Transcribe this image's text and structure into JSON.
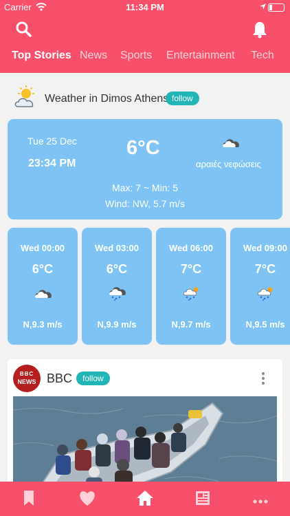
{
  "status": {
    "carrier": "Carrier",
    "time": "11:34 PM"
  },
  "tabs": [
    "Top Stories",
    "News",
    "Sports",
    "Entertainment",
    "Tech"
  ],
  "weather": {
    "title": "Weather in Dimos Athens",
    "follow_label": "follow",
    "date": "Tue 25 Dec",
    "time": "23:34 PM",
    "temp": "6°C",
    "condition": "αραιές νεφώσεις",
    "maxmin": "Max: 7 ~ Min: 5",
    "wind": "Wind: NW, 5.7 m/s"
  },
  "forecast": [
    {
      "time": "Wed 00:00",
      "temp": "6°C",
      "wind": "N,9.3 m/s",
      "icon": "cloudy-icon"
    },
    {
      "time": "Wed 03:00",
      "temp": "6°C",
      "wind": "N,9.9 m/s",
      "icon": "rain-cloud-icon"
    },
    {
      "time": "Wed 06:00",
      "temp": "7°C",
      "wind": "N,9.7 m/s",
      "icon": "rain-sun-icon"
    },
    {
      "time": "Wed 09:00",
      "temp": "7°C",
      "wind": "N,9.5 m/s",
      "icon": "rain-sun-icon"
    }
  ],
  "news": {
    "source": "BBC",
    "follow_label": "follow",
    "logo_text": [
      "BBC",
      "NEWS"
    ]
  },
  "colors": {
    "accent": "#f8506a",
    "card": "#7ec3f3",
    "follow": "#21b5b5"
  }
}
